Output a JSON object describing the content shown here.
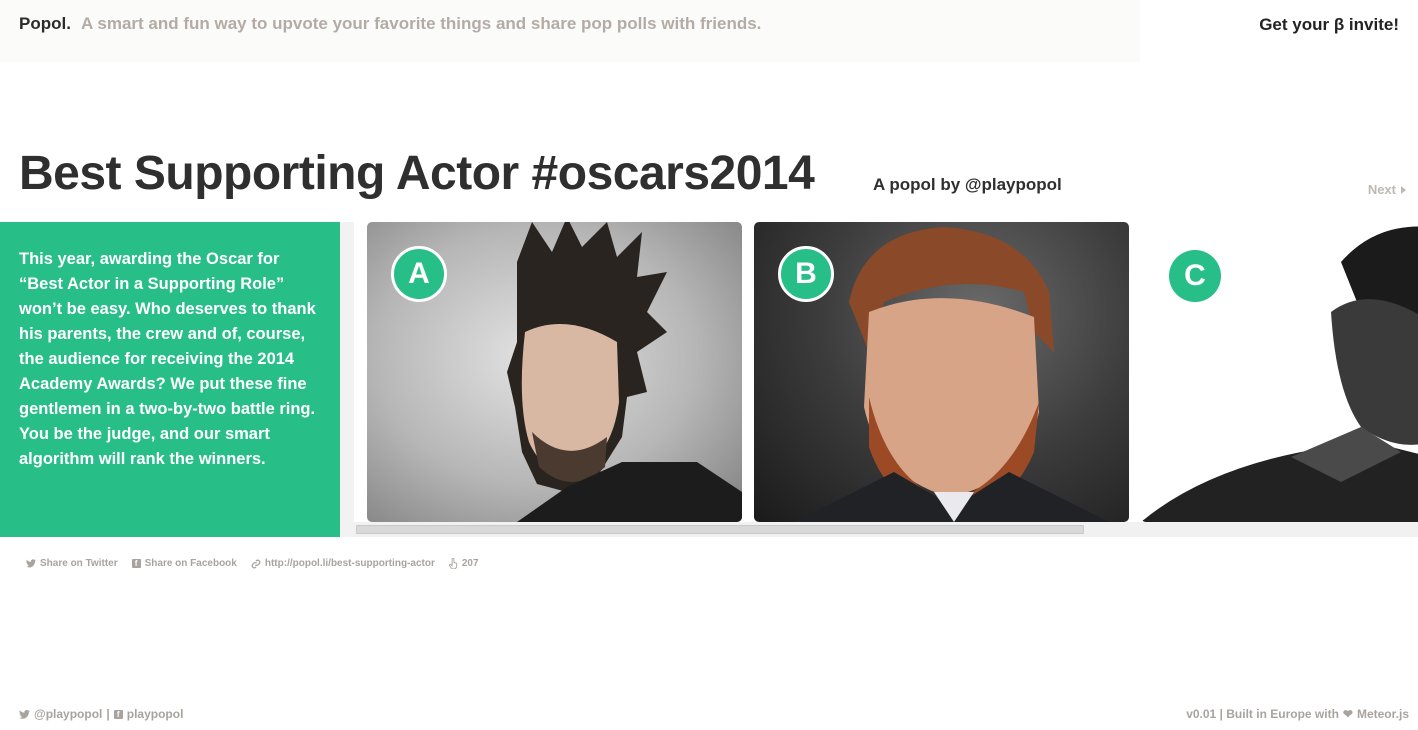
{
  "header": {
    "brand": "Popol.",
    "tagline": "A smart and fun way to upvote your favorite things and share pop polls with friends.",
    "invite": "Get your β invite!"
  },
  "poll": {
    "title": "Best Supporting Actor #oscars2014",
    "byline": "A popol by @playpopol",
    "next_label": "Next",
    "description": "This year, awarding the Oscar for “Best Actor in a Supporting Role” won’t be easy. Who deserves to thank his parents, the crew and of, course, the audience for receiving the 2014 Academy Awards? We put these fine gentlemen in a two-by-two battle ring. You be the judge, and our smart algorithm will rank the winners.",
    "options": [
      {
        "letter": "A"
      },
      {
        "letter": "B"
      },
      {
        "letter": "C"
      }
    ]
  },
  "share": {
    "twitter": "Share on Twitter",
    "facebook": "Share on Facebook",
    "link": "http://popol.li/best-supporting-actor",
    "count": "207"
  },
  "footer": {
    "twitter_handle": "@playpopol",
    "separator": "|",
    "facebook_handle": "playpopol",
    "version_text": "v0.01 | Built in Europe with",
    "meteor": "Meteor.js"
  },
  "colors": {
    "accent": "#27be87",
    "muted": "#a8a39e"
  },
  "icons": [
    "twitter-icon",
    "facebook-icon",
    "link-icon",
    "hand-pointer-icon",
    "heart-icon",
    "chevron-right-icon"
  ]
}
